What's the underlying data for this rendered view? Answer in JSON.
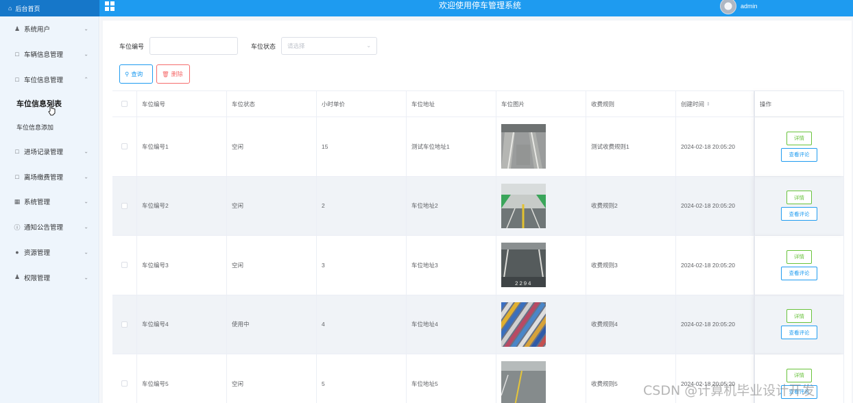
{
  "header": {
    "home_label": "后台首页",
    "title": "欢迎使用停车管理系统",
    "user": "admin"
  },
  "sidebar": {
    "items": [
      {
        "label": "系统用户",
        "icon": "user-icon"
      },
      {
        "label": "车辆信息管理",
        "icon": "doc-icon"
      },
      {
        "label": "车位信息管理",
        "icon": "doc-icon",
        "expanded": true
      },
      {
        "label": "进场记录管理",
        "icon": "doc-icon"
      },
      {
        "label": "离场缴费管理",
        "icon": "doc-icon"
      },
      {
        "label": "系统管理",
        "icon": "picture-icon"
      },
      {
        "label": "通知公告管理",
        "icon": "info-icon"
      },
      {
        "label": "资源管理",
        "icon": "location-icon"
      },
      {
        "label": "权限管理",
        "icon": "user-icon"
      }
    ],
    "submenu": [
      "车位信息列表",
      "车位信息添加"
    ]
  },
  "filters": {
    "code_label": "车位编号",
    "code_value": "",
    "status_label": "车位状态",
    "status_placeholder": "请选择"
  },
  "buttons": {
    "search": "查询",
    "delete": "删除"
  },
  "table": {
    "columns": [
      "车位编号",
      "车位状态",
      "小时单价",
      "车位地址",
      "车位图片",
      "收费规则",
      "创建时间",
      "操作"
    ],
    "rows": [
      {
        "code": "车位编号1",
        "status": "空闲",
        "price": "15",
        "address": "测试车位地址1",
        "rule": "测试收费规则1",
        "created": "2024-02-18 20:05:20",
        "image": "parking-photo-1"
      },
      {
        "code": "车位编号2",
        "status": "空闲",
        "price": "2",
        "address": "车位地址2",
        "rule": "收费规则2",
        "created": "2024-02-18 20:05:20",
        "image": "parking-photo-2"
      },
      {
        "code": "车位编号3",
        "status": "空闲",
        "price": "3",
        "address": "车位地址3",
        "rule": "收费规则3",
        "created": "2024-02-18 20:05:20",
        "image": "parking-photo-3"
      },
      {
        "code": "车位编号4",
        "status": "使用中",
        "price": "4",
        "address": "车位地址4",
        "rule": "收费规则4",
        "created": "2024-02-18 20:05:20",
        "image": "parking-photo-4"
      },
      {
        "code": "车位编号5",
        "status": "空闲",
        "price": "5",
        "address": "车位地址5",
        "rule": "收费规则5",
        "created": "2024-02-18 20:05:20",
        "image": "parking-photo-5"
      }
    ],
    "detail_label": "详情",
    "review_label": "查看评论"
  },
  "watermark": "CSDN @计算机毕业设计开发",
  "photo_text": "2294",
  "colors": {
    "primary": "#1e9bf0",
    "sidebar_bg": "#eef5fc",
    "success": "#67c23a",
    "danger": "#f56c6c"
  }
}
